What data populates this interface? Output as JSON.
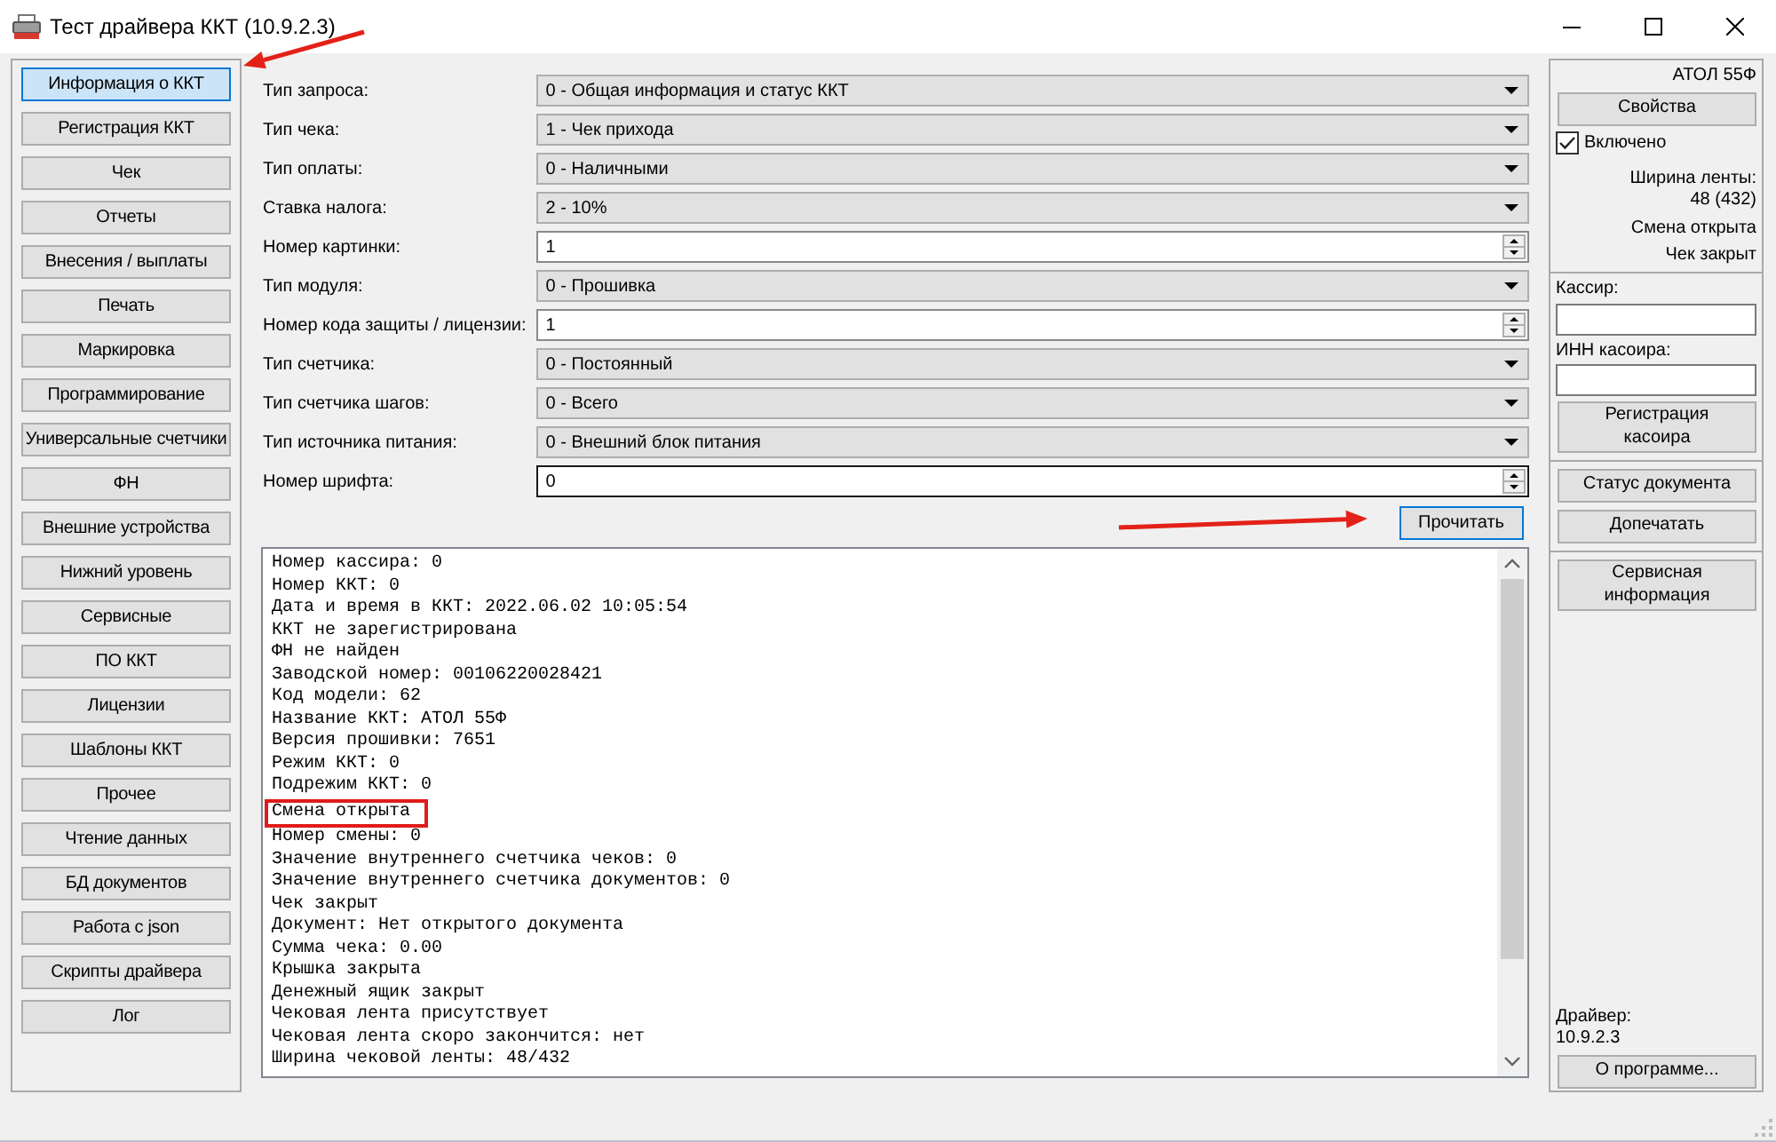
{
  "window": {
    "title": "Тест драйвера ККТ (10.9.2.3)"
  },
  "nav": {
    "items": [
      {
        "label": "Информация о ККТ",
        "selected": true
      },
      {
        "label": "Регистрация ККТ",
        "selected": false
      },
      {
        "label": "Чек",
        "selected": false
      },
      {
        "label": "Отчеты",
        "selected": false
      },
      {
        "label": "Внесения / выплаты",
        "selected": false
      },
      {
        "label": "Печать",
        "selected": false
      },
      {
        "label": "Маркировка",
        "selected": false
      },
      {
        "label": "Программирование",
        "selected": false
      },
      {
        "label": "Универсальные счетчики",
        "selected": false
      },
      {
        "label": "ФН",
        "selected": false
      },
      {
        "label": "Внешние устройства",
        "selected": false
      },
      {
        "label": "Нижний уровень",
        "selected": false
      },
      {
        "label": "Сервисные",
        "selected": false
      },
      {
        "label": "ПО ККТ",
        "selected": false
      },
      {
        "label": "Лицензии",
        "selected": false
      },
      {
        "label": "Шаблоны ККТ",
        "selected": false
      },
      {
        "label": "Прочее",
        "selected": false
      },
      {
        "label": "Чтение данных",
        "selected": false
      },
      {
        "label": "БД документов",
        "selected": false
      },
      {
        "label": "Работа с json",
        "selected": false
      },
      {
        "label": "Скрипты драйвера",
        "selected": false
      },
      {
        "label": "Лог",
        "selected": false
      }
    ]
  },
  "form": {
    "fields": [
      {
        "label": "Тип запроса:",
        "kind": "combo",
        "value": "0 - Общая информация и статус ККТ"
      },
      {
        "label": "Тип чека:",
        "kind": "combo",
        "value": "1 - Чек прихода"
      },
      {
        "label": "Тип оплаты:",
        "kind": "combo",
        "value": "0 - Наличными"
      },
      {
        "label": "Ставка налога:",
        "kind": "combo",
        "value": "2 - 10%"
      },
      {
        "label": "Номер картинки:",
        "kind": "spin",
        "value": "1",
        "focused": false
      },
      {
        "label": "Тип модуля:",
        "kind": "combo",
        "value": "0 - Прошивка"
      },
      {
        "label": "Номер кода защиты / лицензии:",
        "kind": "spin",
        "value": "1",
        "focused": false
      },
      {
        "label": "Тип счетчика:",
        "kind": "combo",
        "value": "0 - Постоянный"
      },
      {
        "label": "Тип счетчика шагов:",
        "kind": "combo",
        "value": "0 - Всего"
      },
      {
        "label": "Тип источника питания:",
        "kind": "combo",
        "value": "0 - Внешний блок питания"
      },
      {
        "label": "Номер шрифта:",
        "kind": "spin",
        "value": "0",
        "focused": true
      }
    ],
    "read_button": "Прочитать"
  },
  "log": {
    "lines": [
      {
        "text": "Номер кассира: 0",
        "highlighted": false
      },
      {
        "text": "Номер ККТ: 0",
        "highlighted": false
      },
      {
        "text": "Дата и время в ККТ: 2022.06.02 10:05:54",
        "highlighted": false
      },
      {
        "text": "ККТ не зарегистрирована",
        "highlighted": false
      },
      {
        "text": "ФН не найден",
        "highlighted": false
      },
      {
        "text": "Заводской номер: 00106220028421",
        "highlighted": false
      },
      {
        "text": "Код модели: 62",
        "highlighted": false
      },
      {
        "text": "Название ККТ: АТОЛ 55Ф",
        "highlighted": false
      },
      {
        "text": "Версия прошивки: 7651",
        "highlighted": false
      },
      {
        "text": "Режим ККТ: 0",
        "highlighted": false
      },
      {
        "text": "Подрежим ККТ: 0",
        "highlighted": false
      },
      {
        "text": "Смена открыта",
        "highlighted": true
      },
      {
        "text": "Номер смены: 0",
        "highlighted": false
      },
      {
        "text": "Значение внутреннего счетчика чеков: 0",
        "highlighted": false
      },
      {
        "text": "Значение внутреннего счетчика документов: 0",
        "highlighted": false
      },
      {
        "text": "Чек закрыт",
        "highlighted": false
      },
      {
        "text": "Документ: Нет открытого документа",
        "highlighted": false
      },
      {
        "text": "Сумма чека: 0.00",
        "highlighted": false
      },
      {
        "text": "Крышка закрыта",
        "highlighted": false
      },
      {
        "text": "Денежный ящик закрыт",
        "highlighted": false
      },
      {
        "text": "Чековая лента присутствует",
        "highlighted": false
      },
      {
        "text": "Чековая лента скоро закончится: нет",
        "highlighted": false
      },
      {
        "text": "Ширина чековой ленты: 48/432",
        "highlighted": false
      }
    ]
  },
  "device": {
    "model": "АТОЛ 55Ф",
    "properties_button": "Свойства",
    "enabled": {
      "label": "Включено",
      "checked": true
    },
    "tape_width_label": "Ширина ленты:",
    "tape_width": "48 (432)",
    "shift_status": "Смена открыта",
    "receipt_status": "Чек закрыт",
    "fields": [
      {
        "label": "Кассир:"
      },
      {
        "label": "ИНН касоира:"
      }
    ],
    "button_groups": [
      {
        "buttons": [
          "Регистрация касоира"
        ]
      },
      {
        "buttons": [
          "Статус документа",
          "Допечатать"
        ]
      },
      {
        "buttons": [
          "Сервисная информация"
        ]
      }
    ],
    "driver_label": "Драйвер:",
    "driver_version": "10.9.2.3",
    "about_button": "О программе..."
  }
}
